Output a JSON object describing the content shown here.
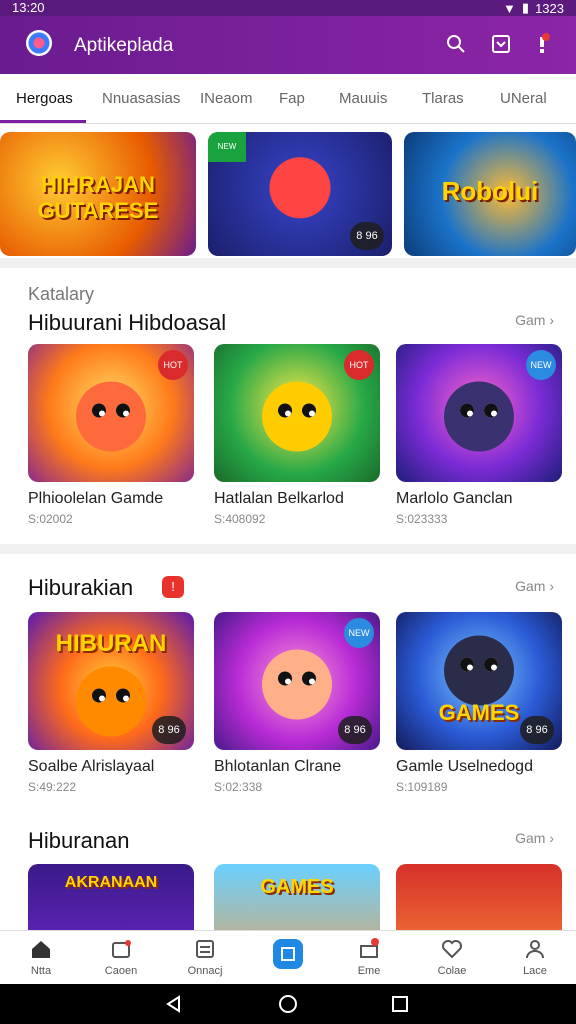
{
  "status": {
    "time": "13:20",
    "battery": "1323"
  },
  "appbar": {
    "title": "Aptikeplada",
    "colors": {
      "bg": "#7a1fa2"
    },
    "icons": [
      "search-icon",
      "download-box-icon",
      "notification-icon"
    ]
  },
  "tabs": [
    {
      "label": "Hergoas",
      "active": true
    },
    {
      "label": "Nnuasasias"
    },
    {
      "label": "INeaom"
    },
    {
      "label": "Fap"
    },
    {
      "label": "Mauuis"
    },
    {
      "label": "Tlaras"
    },
    {
      "label": "UNeral"
    }
  ],
  "banners": [
    {
      "title": "HIHRAJAN GUTARESE"
    },
    {
      "title": "",
      "tag": "NEW",
      "badge": "8 96"
    },
    {
      "title": "Robolui"
    }
  ],
  "section1": {
    "subcategory": "Katalary",
    "title": "Hibuurani Hibdoasal",
    "more": "Gam",
    "cards": [
      {
        "name": "Plhioolelan Gamde",
        "price": "S:02002",
        "tag": "HOT"
      },
      {
        "name": "Hatlalan Belkarlod",
        "price": "S:408092",
        "tag": "HOT"
      },
      {
        "name": "Marlolo Ganclan",
        "price": "S:023333",
        "tag": "NEW"
      }
    ]
  },
  "section2": {
    "title": "Hiburakian",
    "badge": "!",
    "more": "Gam",
    "cards": [
      {
        "name": "Soalbe Alrislayaal",
        "price": "S:49:222",
        "banner": "HIBURAN",
        "badge": "8 96"
      },
      {
        "name": "Bhlotanlan Clrane",
        "price": "S:02:338",
        "badge": "8 96",
        "tag": "NEW"
      },
      {
        "name": "Gamle Uselnedogd",
        "price": "S:109189",
        "banner": "GAMES",
        "badge": "8 96"
      }
    ]
  },
  "section3": {
    "title": "Hiburanan",
    "more": "Gam",
    "cards": [
      {
        "banner": "AKRANAAN"
      },
      {
        "banner": "GAMES"
      },
      {
        "banner": ""
      }
    ]
  },
  "bottomnav": [
    {
      "label": "Ntta",
      "icon": "home-icon"
    },
    {
      "label": "Caoen",
      "icon": "box-icon"
    },
    {
      "label": "Onnacj",
      "icon": "list-icon"
    },
    {
      "label": "",
      "icon": "apps-icon"
    },
    {
      "label": "Eme",
      "icon": "gift-icon"
    },
    {
      "label": "Colae",
      "icon": "heart-icon"
    },
    {
      "label": "Lace",
      "icon": "person-icon"
    }
  ]
}
